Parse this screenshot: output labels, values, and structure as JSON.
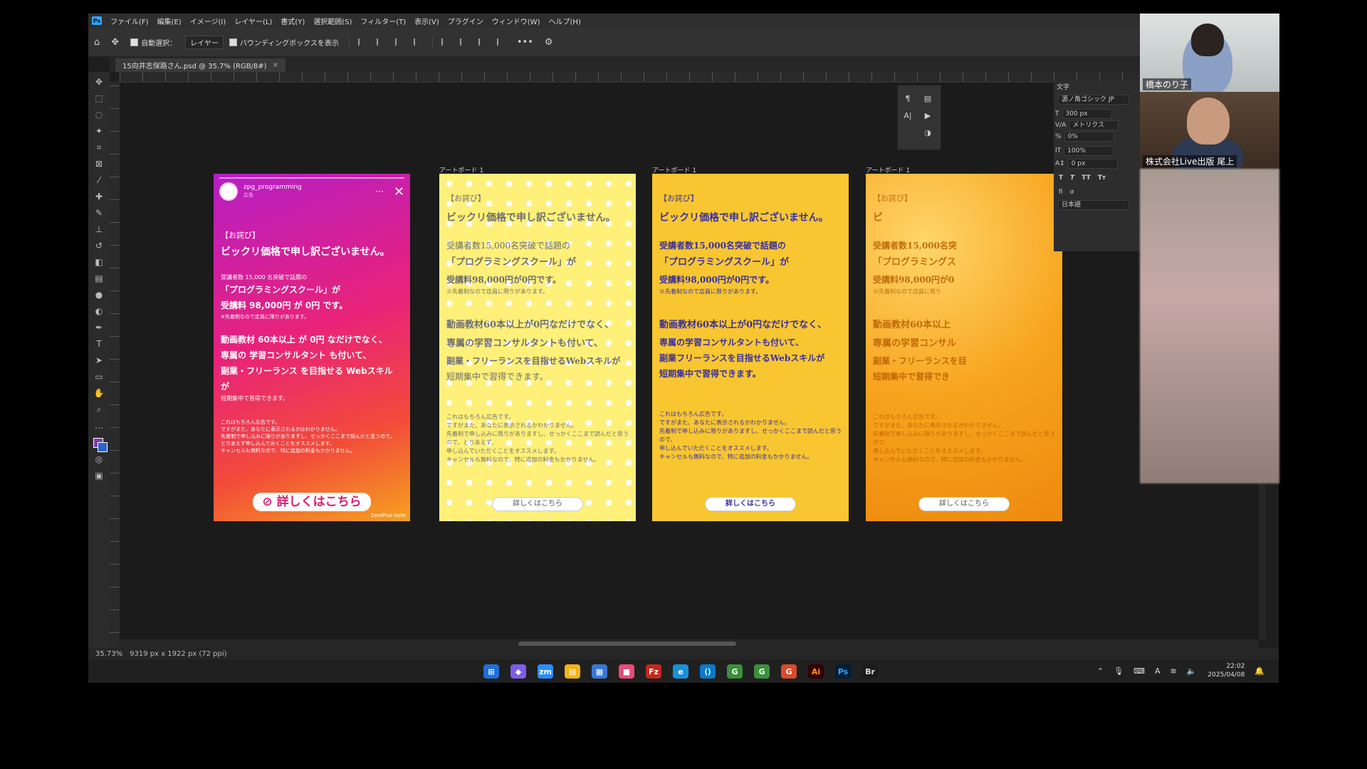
{
  "menu": [
    "ファイル(F)",
    "編集(E)",
    "イメージ(I)",
    "レイヤー(L)",
    "書式(Y)",
    "選択範囲(S)",
    "フィルター(T)",
    "表示(V)",
    "プラグイン",
    "ウィンドウ(W)",
    "ヘルプ(H)"
  ],
  "options": {
    "auto_select": "自動選択：",
    "layer_select": "レイヤー",
    "bounding_box": "バウンディングボックスを表示"
  },
  "tab": {
    "label": "15向井志保路さん.psd @ 35.7% (RGB/8#)",
    "close": "×"
  },
  "status": {
    "zoom": "35.73%",
    "size": "9319 px x 1922 px (72 ppi)"
  },
  "artboards": [
    {
      "label": "",
      "account": "zpg_programming",
      "sponsored": "広告",
      "t1": "【お詫び】",
      "t2": "ビックリ価格で申し訳ございません。",
      "t3": "受講者数 15,000 名突破で話題の",
      "t4": "「プログラミングスクール」が",
      "t5": "受講料 98,000円 が 0円 です。",
      "t6": "※先着制なので定員に限りがあります。",
      "t7": "動画教材 60本以上 が 0円 なだけでなく、",
      "t8": "専属の 学習コンサルタント も付いて、",
      "t9": "副業・フリーランス を目指せる Webスキル が",
      "t10": "短期集中で習得できます。",
      "t11": "これはもちろん広告です。",
      "t12": "ですがまた、あなたに表示されるかはわかりません。",
      "t13": "先着制で申し込みに限りがありますし、せっかくここまで読んだと思うので、",
      "t14": "とりあえず申し込んでおくことをオススメします。",
      "t15": "キャンセルも無料なので、特に追加の料金もかかりません。",
      "cta": "詳しくはこちら",
      "brand": "ZeroPlus Gate"
    },
    {
      "label": "アートボード 1",
      "t1": "【お詫び】",
      "t2": "ビックリ価格で申し訳ございません。",
      "t3": "受講者数15,000名突破で話題の",
      "t4": "「プログラミングスクール」が",
      "t5": "受講料98,000円が0円です。",
      "t6": "※先着制なので店員に限りがあります。",
      "t7": "動画教材60本以上が0円なだけでなく、",
      "t8": "専属の学習コンサルタントも付いて、",
      "t9": "副業・フリーランスを目指せるWebスキルが",
      "t10": "短期集中で習得できます。",
      "t11": "これはもちろん広告です。",
      "t12": "ですがまた、あなたに表示されるかわかりません。",
      "t13": "先着制で申し込みに限りがありますし、せっかくここまで読んだと思うので、とりあえず、",
      "t14": "申し込んでいただくことをオススメします。",
      "t15": "キャンセルも無料なので、特に追加の料金もかかりません。",
      "cta": "詳しくはこちら"
    },
    {
      "label": "アートボード 1",
      "t1": "【お詫び】",
      "t2": "ビックリ価格で申し訳ございません。",
      "t3": "受講者数15,000名突破で話題の",
      "t4": "「プログラミングスクール」が",
      "t5": "受講料98,000円が0円です。",
      "t6": "※先着制なので店員に限りがあります。",
      "t7": "動画教材60本以上が0円なだけでなく、",
      "t8": "専属の学習コンサルタントも付いて、",
      "t9": "副業フリーランスを目指せるWebスキルが",
      "t10": "短期集中で習得できます。",
      "t11": "これはもちろん広告です。",
      "t12": "ですがまた、あなたに表示されるかわかりません。",
      "t13": "先着制で申し込みに限りがありますし、せっかくここまで読んだと思うので、",
      "t14": "申し込んでいただくことをオススメします。",
      "t15": "キャンセルも無料なので、特に追加の料金もかかりません。",
      "cta": "詳しくはこちら"
    },
    {
      "label": "アートボード 1",
      "t1": "【お詫び】",
      "t2": "ビ",
      "t3": "受講者数15,000名突",
      "t4": "「プログラミングス",
      "t5": "受講料98,000円が0",
      "t6": "※先着制なので店員に限り",
      "t7": "動画教材60本以上",
      "t8": "専属の学習コンサル",
      "t9": "副業・フリーランスを目",
      "t10": "短期集中で習得でき",
      "t11": "これはもちろん広告です。",
      "t12": "ですがまた、あなたに表示されるかわかりません。",
      "t13": "先着制で申し込みに限りがありますし、せっかくここまで読んだと思うので、",
      "t14": "申し込んでいただくことをオススメします。",
      "t15": "キャンセルも無料なので、特に追加の料金もかかりません。",
      "cta": "詳しくはこちら"
    }
  ],
  "char_panel": {
    "title": "文字",
    "font": "源ノ角ゴシック JP",
    "size": "300 px",
    "kerning": "メトリクス",
    "tracking": "0%",
    "scale": "100%",
    "baseline": "0 px",
    "language": "日本語"
  },
  "cams": [
    {
      "name": "橋本のり子"
    },
    {
      "name": "株式会社Live出版 尾上"
    }
  ],
  "taskbar": {
    "time": "22:02",
    "date": "2025/04/08",
    "apps": [
      "⊞",
      "◆",
      "zm",
      "▤",
      "▦",
      "■",
      "Fz",
      "e",
      "⟨⟩",
      "G",
      "G",
      "G",
      "Ai",
      "Ps",
      "Br"
    ]
  },
  "colors": {
    "accent_ps": "#31a8ff",
    "fg_swatch": "#7d3da8",
    "bg_swatch": "#2a62c9"
  }
}
